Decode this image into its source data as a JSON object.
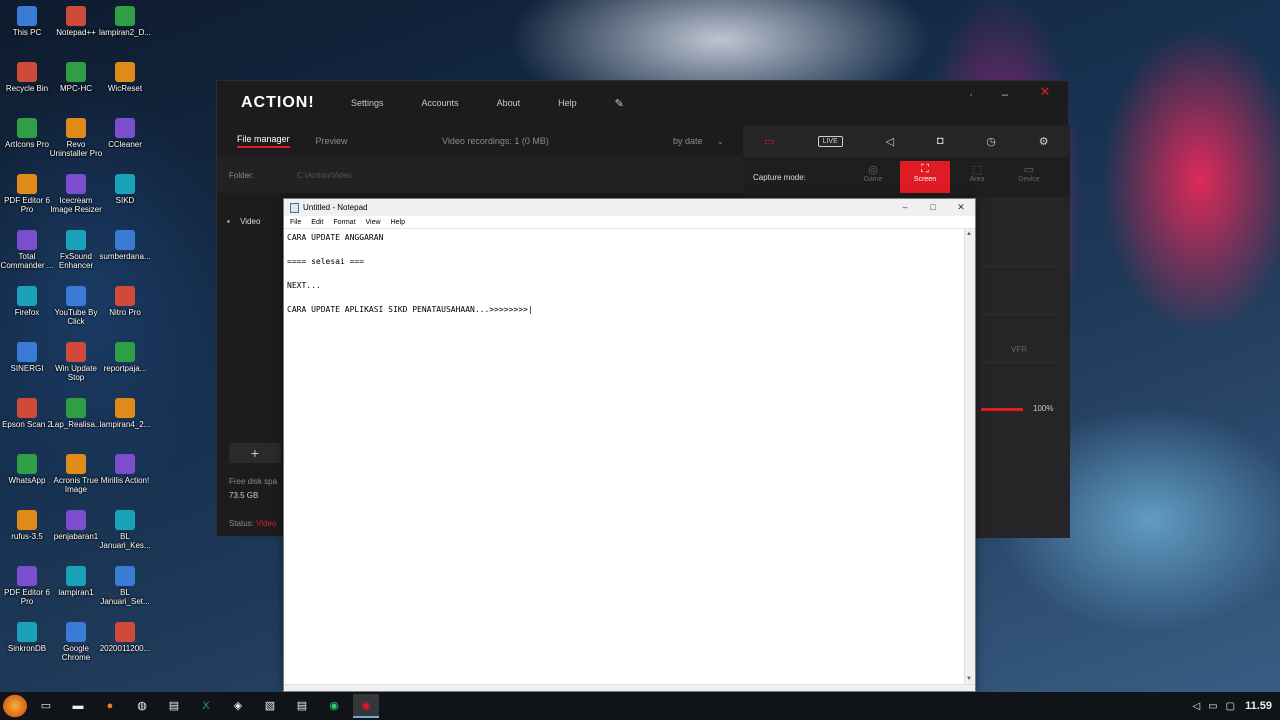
{
  "desktop": {
    "col1": [
      "This PC",
      "Recycle Bin",
      "ArtIcons Pro",
      "PDF Editor 6 Pro",
      "Total Commander ...",
      "Firefox",
      "SINERGI",
      "Epson Scan 2",
      "WhatsApp",
      "rufus-3.5",
      "PDF Editor 6 Pro",
      "SinkronDB"
    ],
    "col2": [
      "Notepad++",
      "MPC-HC",
      "Revo Uninstaller Pro",
      "Icecream Image Resizer",
      "FxSound Enhancer",
      "YouTube By Click",
      "Win Update Stop",
      "Lap_Realisa...",
      "Acronis True Image",
      "penjabaran1",
      "lampiran1",
      "Google Chrome"
    ],
    "col3": [
      "lampiran2_D...",
      "WicReset",
      "CCleaner",
      "SIKD",
      "sumberdana...",
      "Nitro Pro",
      "reportpaja...",
      "lampiran4_2...",
      "Mirillis Action!",
      "BL Januari_Kes...",
      "BL Januari_Set...",
      "2020011200..."
    ]
  },
  "action": {
    "logo": "ACTION!",
    "menu": [
      "Settings",
      "Accounts",
      "About",
      "Help"
    ],
    "tabs": {
      "active": "File manager",
      "other": "Preview"
    },
    "recordings": "Video recordings: 1 (0 MB)",
    "sort": "by date",
    "folder_label": "Folder:",
    "folder_path": "C:\\Action\\Video",
    "video_label": "Video",
    "add": "+",
    "disk_label": "Free disk spa",
    "disk_value": "73.5 GB",
    "status_label": "Status:",
    "status_value": "Video",
    "capture_label": "Capture mode:",
    "modes": [
      "Game",
      "Screen",
      "Area",
      "Device"
    ],
    "live": "LIVE",
    "vfr": "VFR",
    "volume": "100%",
    "minimize": "–",
    "close": "✕"
  },
  "notepad": {
    "title": "Untitled - Notepad",
    "menu": [
      "File",
      "Edit",
      "Format",
      "View",
      "Help"
    ],
    "lines": [
      "CARA UPDATE ANGGARAN",
      "",
      "==== selesai ===",
      "",
      "NEXT...",
      "",
      "CARA UPDATE APLIKASI SIKD PENATAUSAHAAN...>>>>>>>>|"
    ]
  },
  "taskbar": {
    "clock": "11.59"
  }
}
